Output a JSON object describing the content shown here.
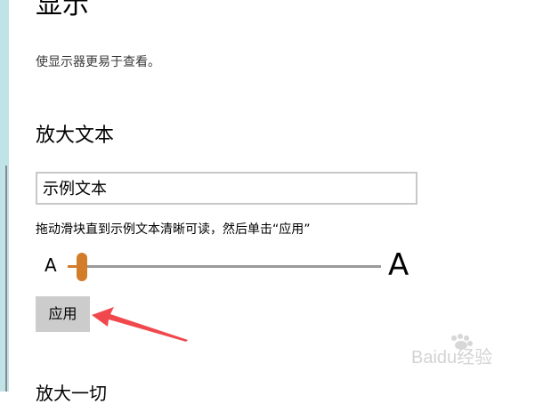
{
  "page": {
    "title": "显示",
    "subtitle": "使显示器更易于查看。"
  },
  "section": {
    "title": "放大文本",
    "sample_text": "示例文本",
    "instruction": "拖动滑块直到示例文本清晰可读，然后单击“应用”"
  },
  "slider": {
    "min_label": "A",
    "max_label": "A",
    "value_fraction": 0.03,
    "accent_color": "#d17d2a"
  },
  "apply_button": {
    "label": "应用"
  },
  "next_section": {
    "title": "放大一切"
  },
  "watermark": {
    "text": "Baidu经验"
  },
  "colors": {
    "annotation_arrow": "#f0484d",
    "button_bg": "#cccccc"
  }
}
